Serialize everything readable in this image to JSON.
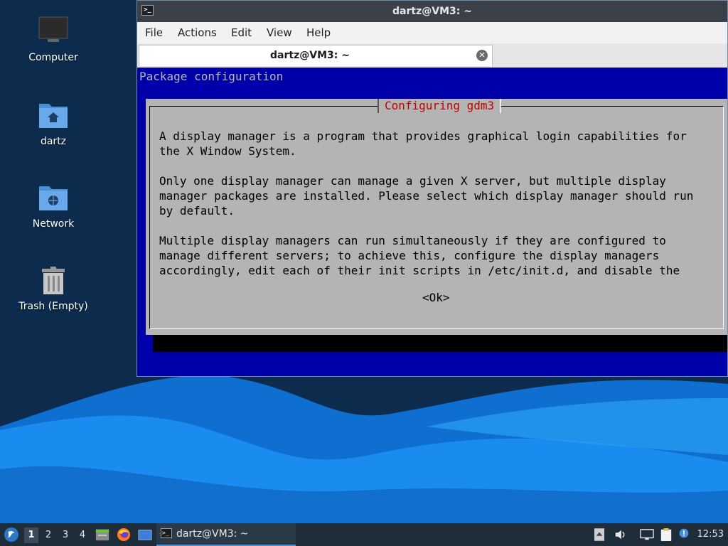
{
  "desktop": {
    "icons": [
      {
        "label": "Computer"
      },
      {
        "label": "dartz"
      },
      {
        "label": "Network"
      },
      {
        "label": "Trash (Empty)"
      }
    ]
  },
  "window": {
    "title": "dartz@VM3: ~",
    "menu": [
      "File",
      "Actions",
      "Edit",
      "View",
      "Help"
    ],
    "tab_label": "dartz@VM3: ~",
    "tab_close": "✕"
  },
  "terminal": {
    "header": "Package configuration",
    "dialog": {
      "title": "Configuring gdm3",
      "lines": [
        "A display manager is a program that provides graphical login capabilities for",
        "the X Window System.",
        "",
        "Only one display manager can manage a given X server, but multiple display",
        "manager packages are installed. Please select which display manager should run",
        "by default.",
        "",
        "Multiple display managers can run simultaneously if they are configured to",
        "manage different servers; to achieve this, configure the display managers",
        "accordingly, edit each of their init scripts in /etc/init.d, and disable the"
      ],
      "ok": "<Ok>"
    }
  },
  "taskbar": {
    "workspaces": [
      "1",
      "2",
      "3",
      "4"
    ],
    "active_workspace": "1",
    "task_label": "dartz@VM3: ~",
    "clock": "12:53"
  },
  "colors": {
    "terminal_bg": "#0000aa",
    "dialog_bg": "#b4b4b4",
    "dialog_title": "#c00000",
    "desktop_bg": "#0d2c4d",
    "wave_light": "#1a8cf0"
  }
}
